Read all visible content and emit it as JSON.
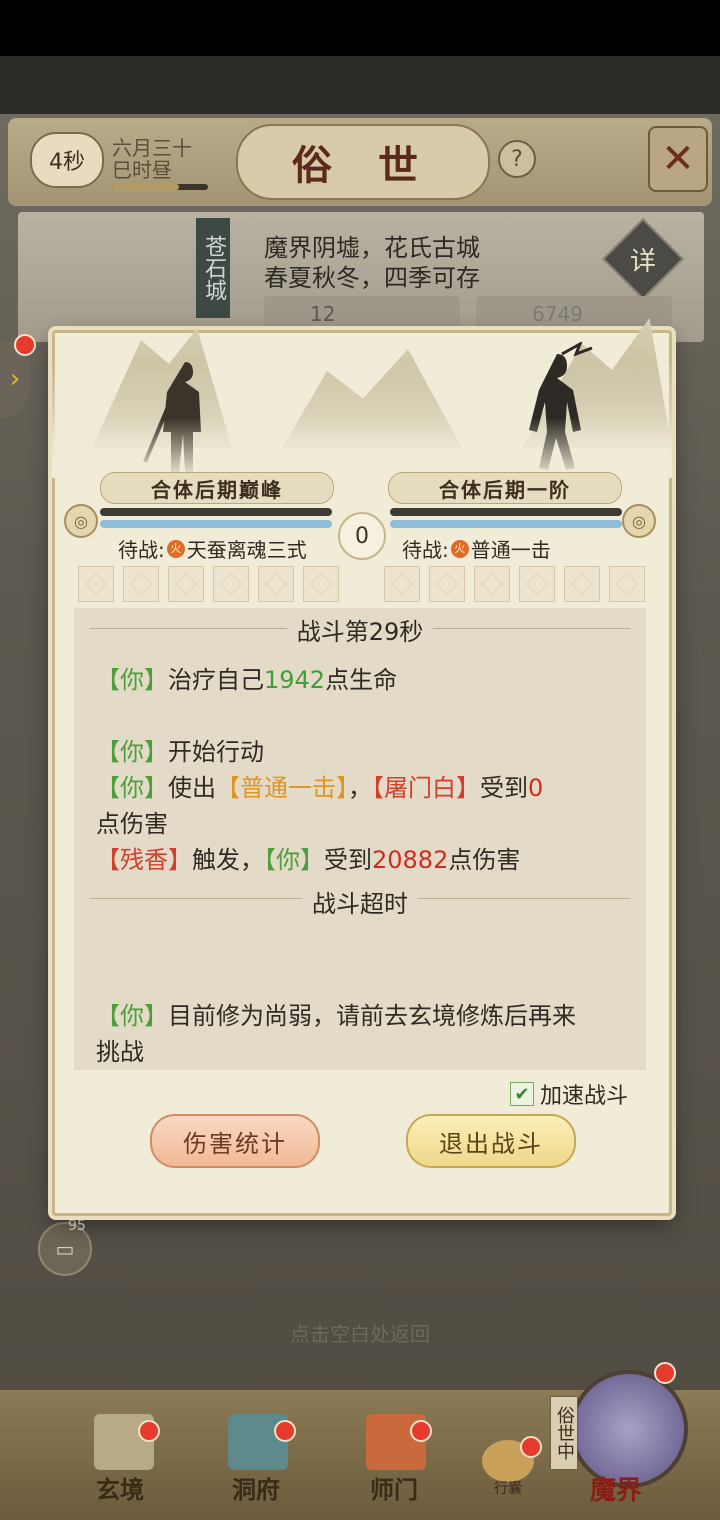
{
  "header": {
    "timer": "4秒",
    "date_line1": "六月三十",
    "date_line2": "巳时昼",
    "title": "俗 世",
    "help": "?",
    "close": "✕"
  },
  "location": {
    "tag": "苍石城",
    "desc_line1": "魔界阴墟，花氏古城",
    "desc_line2": "春夏秋冬，四季可存",
    "detail_label": "详",
    "stat1": "12",
    "stat2": "6749"
  },
  "battle": {
    "player_rank": "合体后期巅峰",
    "enemy_rank": "合体后期一阶",
    "player_hp": 1.0,
    "enemy_hp": 1.0,
    "round_badge": "0",
    "player_wait_prefix": "待战:",
    "player_wait_skill": "天蚕离魂三式",
    "enemy_wait_prefix": "待战:",
    "enemy_wait_skill": "普通一击",
    "fire_glyph": "火"
  },
  "log": {
    "header_partial": "战斗第29秒",
    "lines": {
      "heal_you": "【你】",
      "heal_text": "治疗自己",
      "heal_num": "1942",
      "heal_tail": "点生命",
      "act_you": "【你】",
      "act_text": "开始行动",
      "use_you": "【你】",
      "use_text": "使出",
      "use_skill": "【普通一击】",
      "use_comma": "，",
      "use_target": "【屠门白】",
      "use_recv": "受到",
      "use_num": "0",
      "use_tail": "点伤害",
      "trig_skill": "【残香】",
      "trig_text": "触发，",
      "trig_you": "【你】",
      "trig_recv": "受到",
      "trig_num": "20882",
      "trig_tail": "点伤害",
      "timeout": "战斗超时",
      "weak_you": "【你】",
      "weak_text": "目前修为尚弱，请前去玄境修炼后再来",
      "weak_tail": "挑战"
    }
  },
  "controls": {
    "speed_check": "✔",
    "speed_label": "加速战斗",
    "damage_stats": "伤害统计",
    "exit_battle": "退出战斗"
  },
  "background": {
    "chat_count": "95",
    "dismiss_hint": "点击空白处返回"
  },
  "nav": {
    "items": [
      "玄境",
      "洞府",
      "师门"
    ],
    "bag": "行囊",
    "in_world": "俗世中",
    "mojie": "魔界"
  },
  "colors": {
    "ally_tag": "#4c9f3a",
    "skill": "#e09422",
    "enemy_tag": "#d0402c",
    "damage_num": "#d12c1f",
    "heal_num": "#3f9e3a"
  }
}
